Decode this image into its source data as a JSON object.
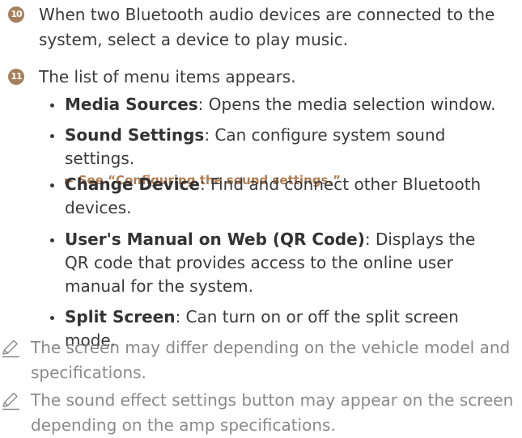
{
  "steps": [
    {
      "number": "10",
      "text": "When two Bluetooth audio devices are connected to the system, select a device to play music."
    },
    {
      "number": "11",
      "text": "The list of menu items appears."
    }
  ],
  "menu_items": [
    {
      "title": "Media Sources",
      "description": ": Opens the media selection window."
    },
    {
      "title": "Sound Settings",
      "description": ": Can configure system sound settings.",
      "reference": "► See “Configuring the sound settings.”"
    },
    {
      "title": "Change Device",
      "description": ": Find and connect other Bluetooth devices."
    },
    {
      "title": "User's Manual on Web (QR Code)",
      "description": ": Displays the QR code that provides access to the online user manual for the system."
    },
    {
      "title": "Split Screen",
      "description": ": Can turn on or off the split screen mode."
    }
  ],
  "notes": [
    {
      "icon": "pencil-note-icon",
      "text": "The screen may differ depending on the vehicle model and specifications."
    },
    {
      "icon": "pencil-note-icon",
      "text": "The sound effect settings button may appear on the screen depending on the amp specifications."
    }
  ],
  "colors": {
    "step_badge": "#a67f5c",
    "reference_link": "#b07d55",
    "note_text": "#8a8a8a",
    "body_text": "#3a3a3a"
  }
}
